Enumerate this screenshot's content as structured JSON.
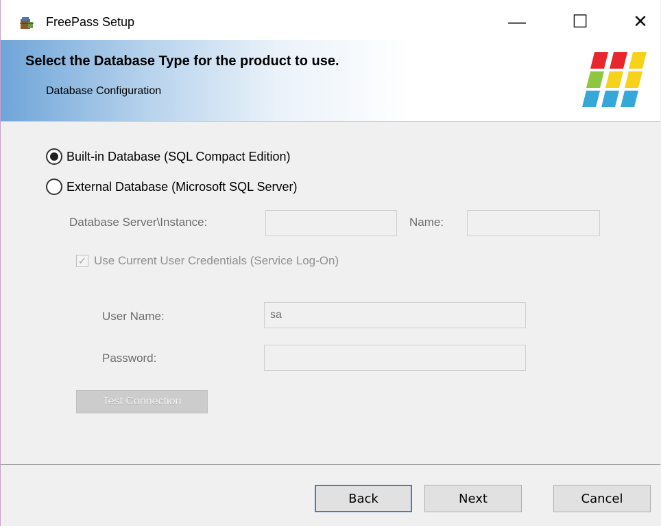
{
  "window": {
    "title": "FreePass Setup",
    "controls": {
      "minimize": "—",
      "maximize": "☐",
      "close": "✕"
    }
  },
  "banner": {
    "title": "Select the Database Type for the product to use.",
    "subtitle": "Database Configuration",
    "logo_colors": [
      "#e8262d",
      "#f7d21a",
      "#8ec63f",
      "#35a7d9"
    ]
  },
  "form": {
    "radio_builtin_label": "Built-in Database (SQL Compact Edition)",
    "radio_builtin_selected": true,
    "radio_external_label": "External Database (Microsoft SQL Server)",
    "radio_external_selected": false,
    "server_label": "Database Server\\Instance:",
    "server_value": "",
    "name_label": "Name:",
    "name_value": "",
    "use_credentials_label": "Use Current User Credentials (Service Log-On)",
    "use_credentials_checked": true,
    "username_label": "User Name:",
    "username_value": "sa",
    "password_label": "Password:",
    "password_value": "",
    "test_connection_label": "Test Connection"
  },
  "footer": {
    "back_label": "Back",
    "next_label": "Next",
    "cancel_label": "Cancel"
  }
}
